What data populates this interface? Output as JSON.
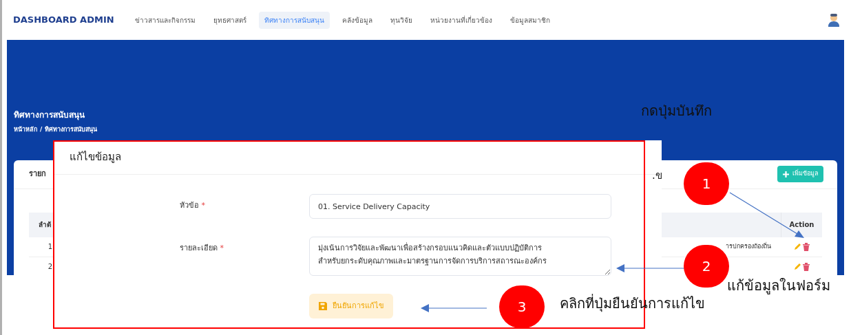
{
  "navbar": {
    "brand": "DASHBOARD ADMIN",
    "items": [
      {
        "label": "ข่าวสารและกิจกรรม",
        "selected": false
      },
      {
        "label": "ยุทธศาสตร์",
        "selected": false
      },
      {
        "label": "ทิศทางการสนับสนุน",
        "selected": true
      },
      {
        "label": "คลังข้อมูล",
        "selected": false
      },
      {
        "label": "ทุนวิจัย",
        "selected": false
      },
      {
        "label": "หน่วยงานที่เกี่ยวข้อง",
        "selected": false
      },
      {
        "label": "ข้อมูลสมาชิก",
        "selected": false
      }
    ]
  },
  "banner": {
    "title": "ทิศทางการสนับสนุน",
    "breadcrumb": [
      "หน้าหลัก",
      "ทิศทางการสนับสนุน"
    ],
    "separator": "/"
  },
  "card": {
    "title_fragment": "รายก",
    "add_button": "เพิ่มข้อมูล",
    "table": {
      "columns": [
        "ลำดั",
        "Action"
      ],
      "rows": [
        {
          "number": "1",
          "text": "ารปกครองถ้องถิ่น"
        },
        {
          "number": "2"
        }
      ]
    }
  },
  "modal": {
    "title": "แก้ไขข้อมูล",
    "fields": [
      {
        "kind": "input",
        "label": "หัวข้อ",
        "required_mark": "*",
        "value": "01. Service Delivery Capacity"
      },
      {
        "kind": "textarea",
        "label": "รายละเอียด",
        "required_mark": "*",
        "value": "มุ่งเน้นการวิจัยและพัฒนาเพื่อสร้างกรอบแนวคิดและตัวแบบปฏิบัติการ\nสำหรับยกระดับคุณภาพและมาตรฐานการจัดการบริการสถารณะองค์กร"
      }
    ],
    "submit_button": "ยืนยันการแก้ไข"
  },
  "annotations": {
    "heading_fragment": ".ข",
    "note_top": "กดปุ่มบันทึก",
    "steps": [
      {
        "number": "1"
      },
      {
        "number": "2",
        "note": "แก้ข้อมูลในฟอร์ม"
      },
      {
        "number": "3",
        "note": "คลิกที่ปุ่มยืนยันการแก้ไข"
      }
    ]
  }
}
